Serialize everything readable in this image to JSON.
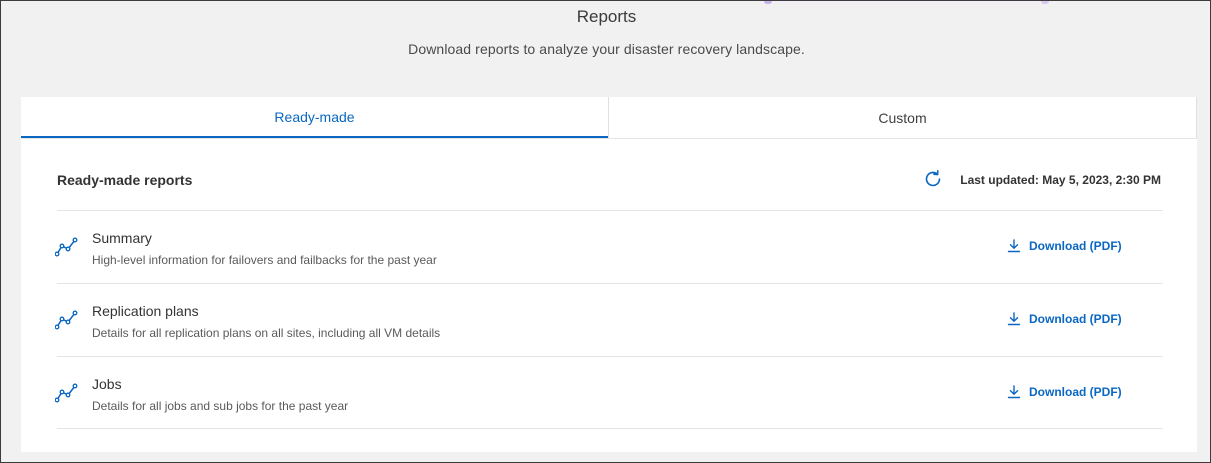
{
  "header": {
    "title": "Reports",
    "subtitle": "Download reports to analyze your disaster recovery landscape."
  },
  "tabs": [
    {
      "label": "Ready-made",
      "active": true
    },
    {
      "label": "Custom",
      "active": false
    }
  ],
  "section": {
    "title": "Ready-made reports",
    "last_updated": "Last updated: May 5, 2023, 2:30 PM",
    "refresh_icon": "refresh-icon"
  },
  "reports": [
    {
      "name": "Summary",
      "description": "High-level information for failovers and failbacks for the past year",
      "action": "Download (PDF)",
      "icon": "line-chart-icon"
    },
    {
      "name": "Replication plans",
      "description": "Details for all replication plans on all sites, including all VM details",
      "action": "Download (PDF)",
      "icon": "line-chart-icon"
    },
    {
      "name": "Jobs",
      "description": "Details for all jobs and sub jobs for the past year",
      "action": "Download (PDF)",
      "icon": "line-chart-icon"
    }
  ],
  "colors": {
    "accent": "#0a67c2",
    "background": "#f1f1f1",
    "panel": "#ffffff"
  }
}
